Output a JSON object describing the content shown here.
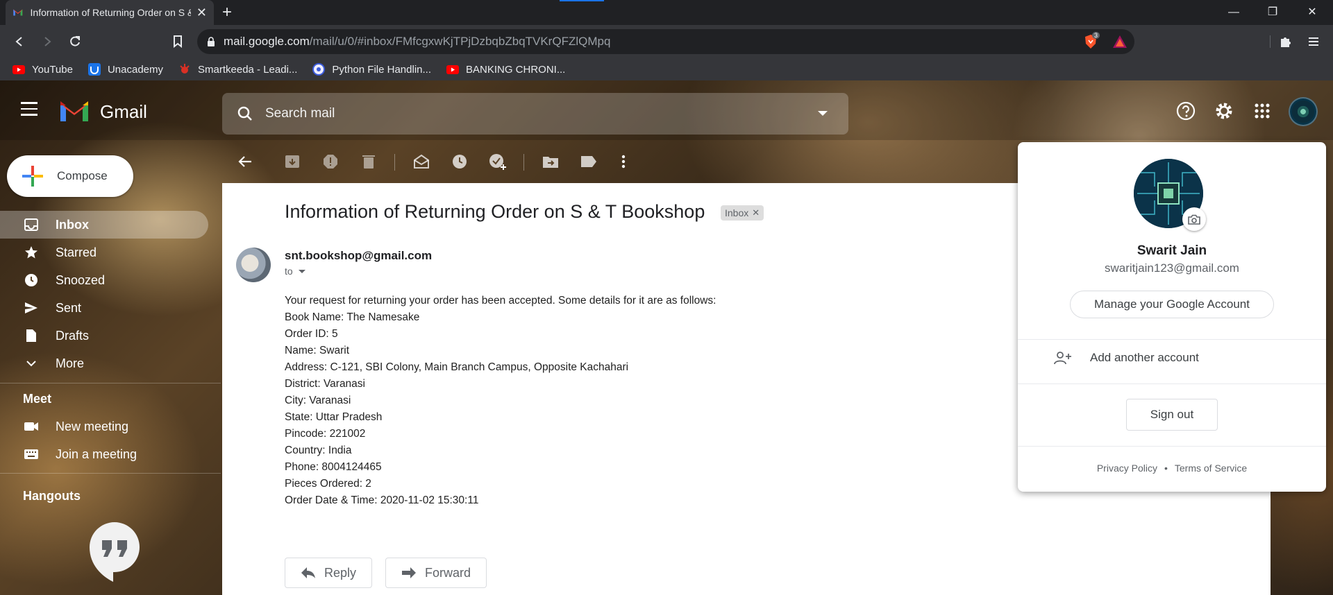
{
  "browser": {
    "tab_title": "Information of Returning Order on S & T Bookshop",
    "url_host": "mail.google.com",
    "url_path": "/mail/u/0/#inbox/FMfcgxwKjTPjDzbqbZbqTVKrQFZlQMpq",
    "brave_badge_count": "3",
    "bookmarks": [
      {
        "label": "YouTube",
        "icon": "youtube-icon"
      },
      {
        "label": "Unacademy",
        "icon": "unacademy-icon"
      },
      {
        "label": "Smartkeeda - Leadi...",
        "icon": "smartkeeda-icon"
      },
      {
        "label": "Python File Handlin...",
        "icon": "python-icon"
      },
      {
        "label": "BANKING CHRONI...",
        "icon": "youtube-icon"
      }
    ]
  },
  "gmail": {
    "wordmark": "Gmail",
    "search_placeholder": "Search mail",
    "compose_label": "Compose",
    "nav": [
      {
        "label": "Inbox",
        "icon": "inbox-icon",
        "active": true
      },
      {
        "label": "Starred",
        "icon": "star-icon"
      },
      {
        "label": "Snoozed",
        "icon": "clock-icon"
      },
      {
        "label": "Sent",
        "icon": "send-icon"
      },
      {
        "label": "Drafts",
        "icon": "draft-icon"
      },
      {
        "label": "More",
        "icon": "chevron-down-icon"
      }
    ],
    "meet": {
      "title": "Meet",
      "items": [
        {
          "label": "New meeting",
          "icon": "video-icon"
        },
        {
          "label": "Join a meeting",
          "icon": "keyboard-icon"
        }
      ]
    },
    "hangouts_title": "Hangouts"
  },
  "email": {
    "subject": "Information of Returning Order on S & T Bookshop",
    "label_chip": "Inbox",
    "sender": "snt.bookshop@gmail.com",
    "to": "to",
    "lines": [
      "Your request for returning your order has been accepted. Some details for it are as follows:",
      "Book Name: The Namesake",
      "Order ID: 5",
      "Name: Swarit",
      "Address: C-121, SBI Colony, Main Branch Campus, Opposite Kachahari",
      "District: Varanasi",
      "City: Varanasi",
      "State: Uttar Pradesh",
      "Pincode: 221002",
      "Country: India",
      "Phone: 8004124465",
      "Pieces Ordered: 2",
      "Order Date & Time: 2020-11-02 15:30:11"
    ],
    "reply_label": "Reply",
    "forward_label": "Forward"
  },
  "account_menu": {
    "name": "Swarit Jain",
    "email": "swaritjain123@gmail.com",
    "manage_label": "Manage your Google Account",
    "add_account_label": "Add another account",
    "sign_out_label": "Sign out",
    "privacy_label": "Privacy Policy",
    "terms_label": "Terms of Service"
  },
  "colors": {
    "gmail_red": "#ea4335",
    "google_blue": "#4285f4",
    "google_green": "#34a853",
    "google_yellow": "#fbbc04",
    "browser_dark": "#202124"
  }
}
